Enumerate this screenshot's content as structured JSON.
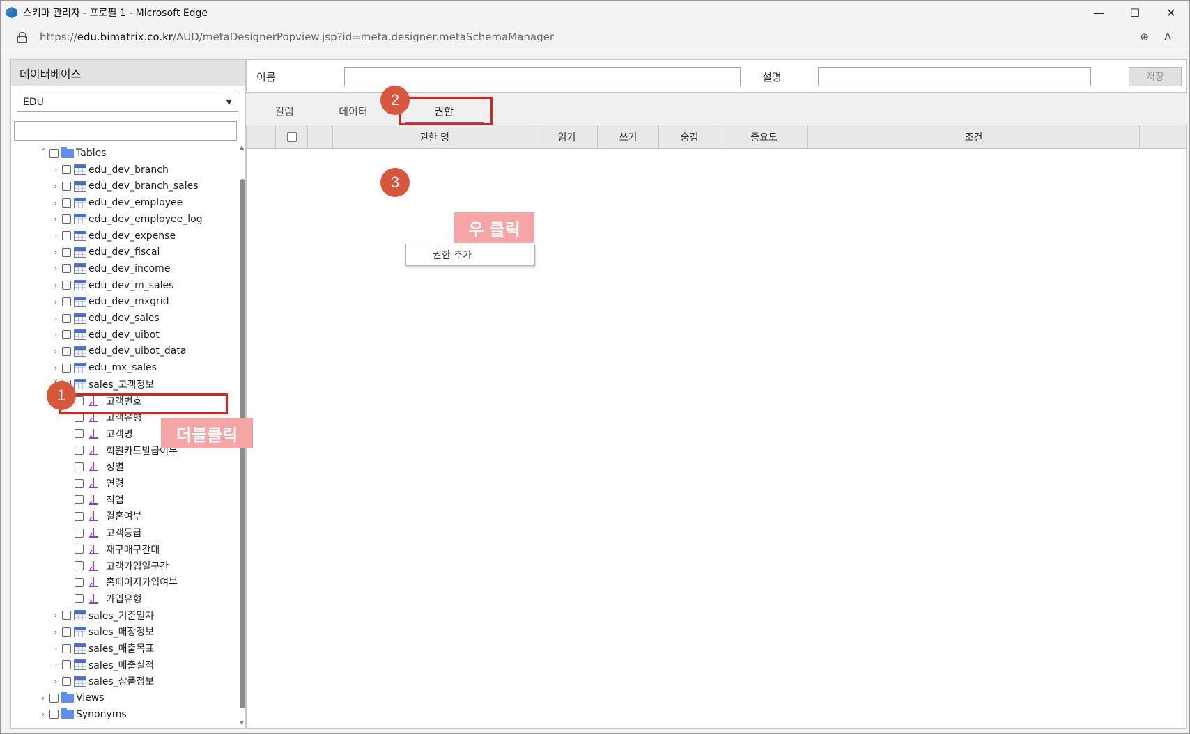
{
  "window": {
    "title": "스키마 관리자 - 프로필 1 - Microsoft Edge",
    "controls": {
      "minimize": "—",
      "maximize": "☐",
      "close": "✕"
    }
  },
  "address": {
    "scheme": "https://",
    "host": "edu.bimatrix.co.kr",
    "path": "/AUD/metaDesignerPopview.jsp?id=meta.designer.metaSchemaManager",
    "icons": [
      "zoom-icon",
      "read-aloud-icon"
    ],
    "zoom_glyph": "⊕",
    "read_aloud_glyph": "A⁾"
  },
  "left_panel": {
    "header": "데이터베이스",
    "db_selected": "EDU",
    "search_value": "",
    "tree": [
      {
        "label": "Tables",
        "type": "folder",
        "level": 0,
        "expanded": true
      },
      {
        "label": "edu_dev_branch",
        "type": "table",
        "level": 1
      },
      {
        "label": "edu_dev_branch_sales",
        "type": "table",
        "level": 1
      },
      {
        "label": "edu_dev_employee",
        "type": "table",
        "level": 1
      },
      {
        "label": "edu_dev_employee_log",
        "type": "table",
        "level": 1
      },
      {
        "label": "edu_dev_expense",
        "type": "table",
        "level": 1
      },
      {
        "label": "edu_dev_fiscal",
        "type": "table",
        "level": 1
      },
      {
        "label": "edu_dev_income",
        "type": "table",
        "level": 1
      },
      {
        "label": "edu_dev_m_sales",
        "type": "table",
        "level": 1
      },
      {
        "label": "edu_dev_mxgrid",
        "type": "table",
        "level": 1
      },
      {
        "label": "edu_dev_sales",
        "type": "table",
        "level": 1
      },
      {
        "label": "edu_dev_uibot",
        "type": "table",
        "level": 1
      },
      {
        "label": "edu_dev_uibot_data",
        "type": "table",
        "level": 1
      },
      {
        "label": "edu_mx_sales",
        "type": "table",
        "level": 1
      },
      {
        "label": "sales_고객정보",
        "type": "table",
        "level": 1,
        "expanded": true
      },
      {
        "label": "고객번호",
        "type": "column",
        "level": 2
      },
      {
        "label": "고객유형",
        "type": "column",
        "level": 2
      },
      {
        "label": "고객명",
        "type": "column",
        "level": 2
      },
      {
        "label": "회원카드발급여부",
        "type": "column",
        "level": 2
      },
      {
        "label": "성별",
        "type": "column",
        "level": 2
      },
      {
        "label": "연령",
        "type": "column",
        "level": 2
      },
      {
        "label": "직업",
        "type": "column",
        "level": 2
      },
      {
        "label": "결혼여부",
        "type": "column",
        "level": 2
      },
      {
        "label": "고객등급",
        "type": "column",
        "level": 2
      },
      {
        "label": "재구매구간대",
        "type": "column",
        "level": 2
      },
      {
        "label": "고객가입일구간",
        "type": "column",
        "level": 2
      },
      {
        "label": "홈페이지가입여부",
        "type": "column",
        "level": 2
      },
      {
        "label": "가입유형",
        "type": "column",
        "level": 2
      },
      {
        "label": "sales_기준일자",
        "type": "table",
        "level": 1
      },
      {
        "label": "sales_매장정보",
        "type": "table",
        "level": 1
      },
      {
        "label": "sales_매출목표",
        "type": "table",
        "level": 1
      },
      {
        "label": "sales_매출실적",
        "type": "table",
        "level": 1
      },
      {
        "label": "sales_상품정보",
        "type": "table",
        "level": 1
      },
      {
        "label": "Views",
        "type": "folder",
        "level": 0
      },
      {
        "label": "Synonyms",
        "type": "folder",
        "level": 0
      }
    ]
  },
  "right_panel": {
    "name_label": "이름",
    "name_value": "",
    "desc_label": "설명",
    "desc_value": "",
    "save_label": "저장",
    "tabs": [
      "컬럼",
      "데이터",
      "권한"
    ],
    "active_tab": "권한",
    "grid_columns": [
      "권한 명",
      "읽기",
      "쓰기",
      "숨김",
      "중요도",
      "조건"
    ],
    "context_menu_item": "권한 추가"
  },
  "annotations": {
    "step1": "1",
    "step2": "2",
    "step3": "3",
    "note_double_click": "더블클릭",
    "note_right_click": "우 클릭",
    "color": "#e0201d",
    "badge_color": "#d8573a"
  }
}
